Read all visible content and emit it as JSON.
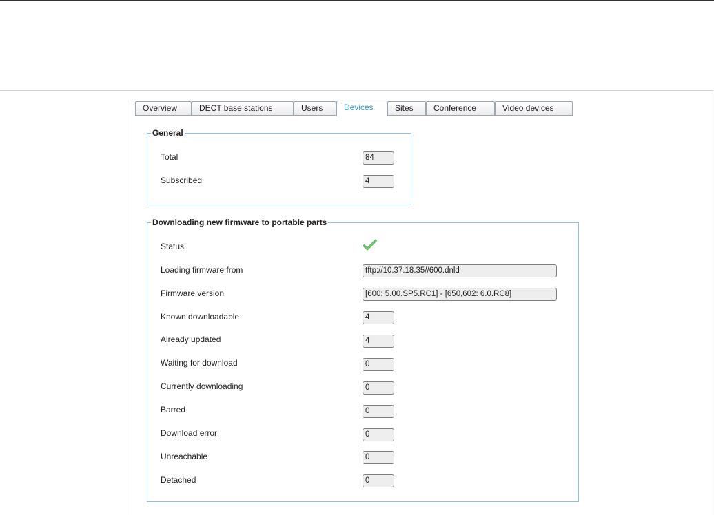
{
  "tabs": [
    {
      "label": "Overview"
    },
    {
      "label": "DECT base stations"
    },
    {
      "label": "Users"
    },
    {
      "label": "Devices"
    },
    {
      "label": "Sites"
    },
    {
      "label": "Conference"
    },
    {
      "label": "Video devices"
    }
  ],
  "active_tab": "Devices",
  "general": {
    "legend": "General",
    "total_label": "Total",
    "total_value": "84",
    "subscribed_label": "Subscribed",
    "subscribed_value": "4"
  },
  "firmware": {
    "legend": "Downloading new firmware to portable parts",
    "status_label": "Status",
    "status_icon": "check-icon",
    "loading_from_label": "Loading firmware from",
    "loading_from_value": "tftp://10.37.18.35//600.dnld",
    "version_label": "Firmware version",
    "version_value": "[600: 5.00.SP5.RC1] - [650,602: 6.0.RC8]",
    "known_label": "Known downloadable",
    "known_value": "4",
    "updated_label": "Already updated",
    "updated_value": "4",
    "waiting_label": "Waiting for download",
    "waiting_value": "0",
    "downloading_label": "Currently downloading",
    "downloading_value": "0",
    "barred_label": "Barred",
    "barred_value": "0",
    "error_label": "Download error",
    "error_value": "0",
    "unreachable_label": "Unreachable",
    "unreachable_value": "0",
    "detached_label": "Detached",
    "detached_value": "0"
  },
  "colors": {
    "accent": "#2b9ad6",
    "group_border": "#8fc2e4",
    "check": "#5cb85c"
  }
}
